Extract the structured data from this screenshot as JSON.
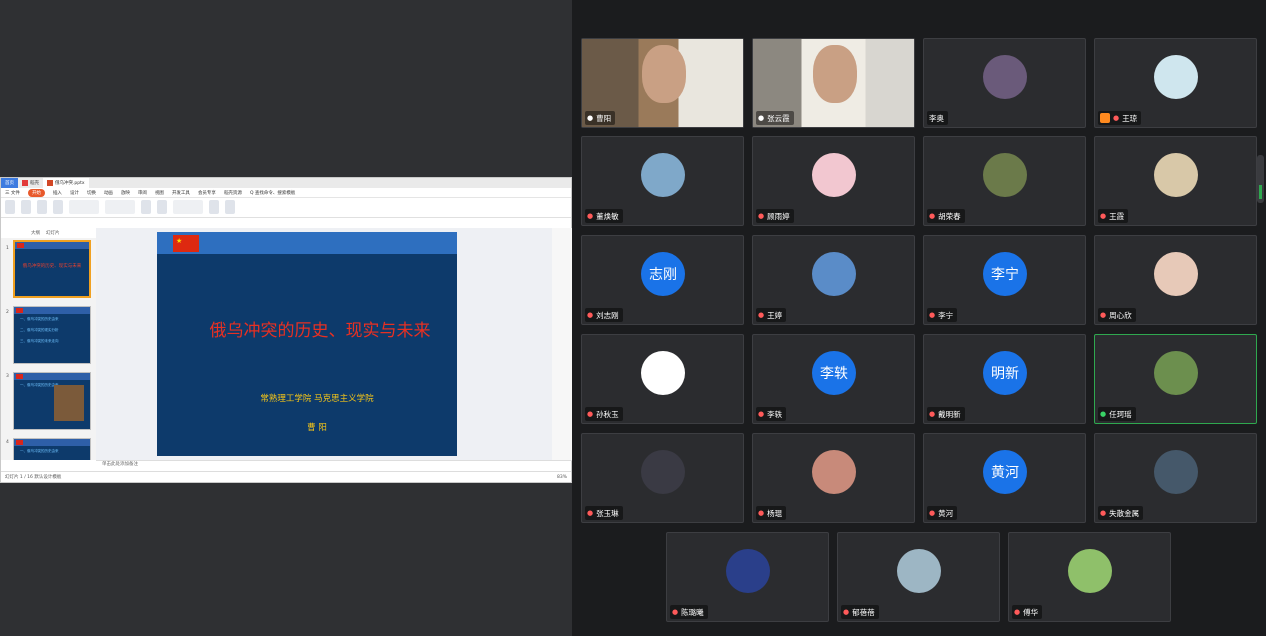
{
  "wps": {
    "tabs": [
      {
        "label": "首页"
      },
      {
        "label": "稻壳"
      },
      {
        "label": "俄乌冲突.pptx"
      }
    ],
    "menu": [
      "三 文件",
      "开始",
      "插入",
      "设计",
      "切换",
      "动画",
      "放映",
      "审阅",
      "视图",
      "开发工具",
      "会员专享",
      "稻壳资源",
      "Q 查找命令、搜索模板"
    ],
    "panel_tabs": [
      "大纲",
      "幻灯片"
    ],
    "notes_placeholder": "单击此处添加备注",
    "status_left": "幻灯片 1 / 16    默认设计模板",
    "status_zoom": "83%"
  },
  "slide": {
    "title": "俄乌冲突的历史、现实与未来",
    "school": "常熟理工学院 马克思主义学院",
    "author": "曹  阳"
  },
  "thumbnails": [
    {
      "num": "1",
      "title": "俄乌冲突的历史、现实与未来"
    },
    {
      "num": "2",
      "lines": [
        "一、俄乌冲突的历史由来",
        "二、俄乌冲突的现实分析",
        "三、俄乌冲突的未来走向"
      ]
    },
    {
      "num": "3",
      "lines": [
        "一、俄乌冲突的历史由来"
      ]
    },
    {
      "num": "4",
      "lines": [
        "一、俄乌冲突的历史由来"
      ]
    }
  ],
  "participants": [
    {
      "name": "曹阳",
      "mic": "on",
      "kind": "video"
    },
    {
      "name": "张云霞",
      "mic": "on",
      "kind": "video"
    },
    {
      "name": "李奥",
      "mic": "none",
      "kind": "image",
      "color": "#6a5a7a"
    },
    {
      "name": "王琼",
      "mic": "off",
      "kind": "image",
      "color": "#cfe6ee",
      "host": true
    },
    {
      "name": "董焕敏",
      "mic": "off",
      "kind": "image",
      "color": "#7fa8c9"
    },
    {
      "name": "顾雨婷",
      "mic": "off",
      "kind": "image",
      "color": "#f2c7d0"
    },
    {
      "name": "胡荣春",
      "mic": "off",
      "kind": "image",
      "color": "#6b7a4a"
    },
    {
      "name": "王霞",
      "mic": "off",
      "kind": "image",
      "color": "#d8c8a8"
    },
    {
      "name": "刘志刚",
      "mic": "off",
      "kind": "text",
      "initials": "志刚"
    },
    {
      "name": "王婷",
      "mic": "off",
      "kind": "image",
      "color": "#5a8cc8"
    },
    {
      "name": "李宁",
      "mic": "off",
      "kind": "text",
      "initials": "李宁"
    },
    {
      "name": "周心欣",
      "mic": "off",
      "kind": "image",
      "color": "#e7c9b8"
    },
    {
      "name": "孙秋玉",
      "mic": "off",
      "kind": "image",
      "color": "#ffffff"
    },
    {
      "name": "李轶",
      "mic": "off",
      "kind": "text",
      "initials": "李轶"
    },
    {
      "name": "戴明新",
      "mic": "off",
      "kind": "text",
      "initials": "明新"
    },
    {
      "name": "任珂瑶",
      "mic": "on",
      "kind": "image",
      "color": "#6c8f4e",
      "talking": true
    },
    {
      "name": "张玉琳",
      "mic": "off",
      "kind": "image",
      "color": "#3a3a44"
    },
    {
      "name": "杨琨",
      "mic": "off",
      "kind": "image",
      "color": "#c88a7a"
    },
    {
      "name": "黄河",
      "mic": "off",
      "kind": "text",
      "initials": "黄河"
    },
    {
      "name": "失散金属",
      "mic": "off",
      "kind": "image",
      "color": "#45586a"
    },
    {
      "name": "陈璐曦",
      "mic": "off",
      "kind": "image",
      "color": "#2a3f8a"
    },
    {
      "name": "郁蓓蓓",
      "mic": "off",
      "kind": "image",
      "color": "#9db6c4"
    },
    {
      "name": "傅华",
      "mic": "off",
      "kind": "image",
      "color": "#8fc06a"
    }
  ]
}
